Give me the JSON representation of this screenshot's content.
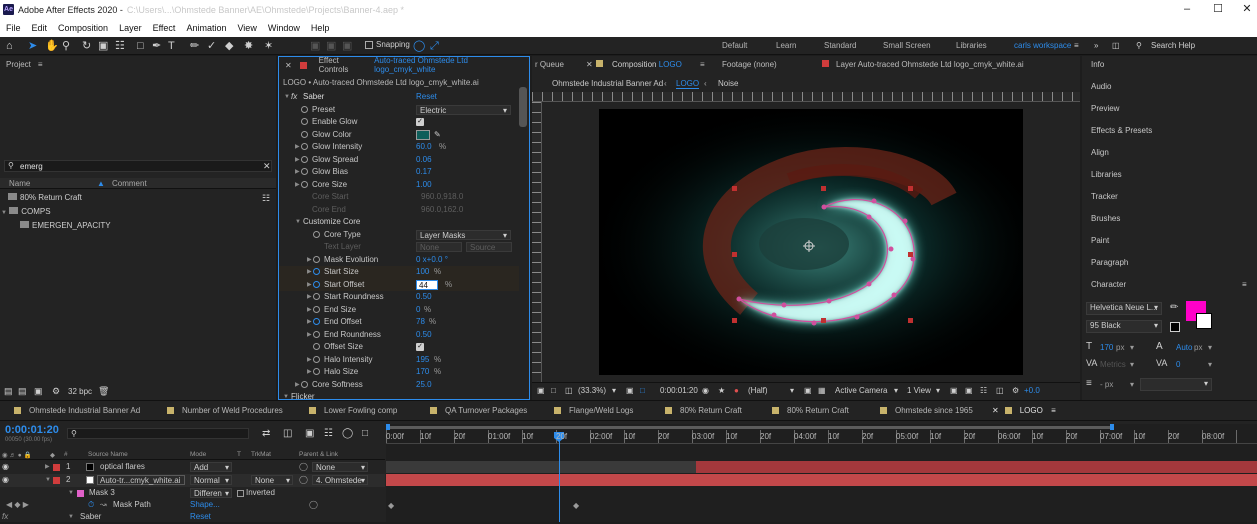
{
  "app": {
    "title": "Adobe After Effects 2020 -",
    "title_faded": "C:\\Users\\...\\Ohmstede Banner\\AE\\Ohmstede\\Projects\\Banner-4.aep *"
  },
  "menu": [
    "File",
    "Edit",
    "Composition",
    "Layer",
    "Effect",
    "Animation",
    "View",
    "Window",
    "Help"
  ],
  "toolbar": {
    "snapping": "Snapping",
    "workspaces": [
      "Default",
      "Learn",
      "Standard",
      "Small Screen",
      "Libraries"
    ],
    "active_workspace": "carls workspace",
    "search_placeholder": "Search Help"
  },
  "project": {
    "title": "Project",
    "search_value": "emerg",
    "col_name": "Name",
    "col_comment": "Comment",
    "items": [
      "80% Return Craft",
      "COMPS",
      "EMERGEN_APACITY"
    ],
    "bpc": "32 bpc"
  },
  "effect_controls": {
    "tab_prefix": "Effect Controls",
    "tab_layer": "Auto-traced Ohmstede Ltd logo_cmyk_white",
    "breadcrumb": "LOGO • Auto-traced Ohmstede Ltd logo_cmyk_white.ai",
    "fx_name": "Saber",
    "reset": "Reset",
    "rows": [
      {
        "label": "Preset",
        "value": "Electric",
        "kind": "dropdown"
      },
      {
        "label": "Enable Glow",
        "value": "✓",
        "kind": "check"
      },
      {
        "label": "Glow Color",
        "value": "",
        "kind": "color"
      },
      {
        "label": "Glow Intensity",
        "value": "60.0",
        "unit": "%"
      },
      {
        "label": "Glow Spread",
        "value": "0.06"
      },
      {
        "label": "Glow Bias",
        "value": "0.17"
      },
      {
        "label": "Core Size",
        "value": "1.00"
      },
      {
        "label": "Core Start",
        "value": "960.0,918.0",
        "kind": "dim"
      },
      {
        "label": "Core End",
        "value": "960.0,162.0",
        "kind": "dim"
      },
      {
        "label": "Customize Core",
        "value": "",
        "kind": "group"
      },
      {
        "label": "Core Type",
        "value": "Layer Masks",
        "kind": "dropdown"
      },
      {
        "label": "Text Layer",
        "value": "None",
        "value2": "Source",
        "kind": "dimdd"
      },
      {
        "label": "Mask Evolution",
        "value": "0 x+0.0 °"
      },
      {
        "label": "Start Size",
        "value": "100",
        "unit": "%"
      },
      {
        "label": "Start Offset",
        "value": "44",
        "unit": "%",
        "kind": "edit"
      },
      {
        "label": "Start Roundness",
        "value": "0.50"
      },
      {
        "label": "End Size",
        "value": "0",
        "unit": "%"
      },
      {
        "label": "End Offset",
        "value": "78",
        "unit": "%"
      },
      {
        "label": "End Roundness",
        "value": "0.50"
      },
      {
        "label": "Offset Size",
        "value": "✓",
        "kind": "check"
      },
      {
        "label": "Halo Intensity",
        "value": "195",
        "unit": "%"
      },
      {
        "label": "Halo Size",
        "value": "170",
        "unit": "%"
      },
      {
        "label": "Core Softness",
        "value": "25.0"
      },
      {
        "label": "Flicker",
        "value": "",
        "kind": "group"
      }
    ]
  },
  "viewer": {
    "tabs": [
      "r Queue",
      "Composition LOGO",
      "Footage (none)",
      "Layer Auto-traced Ohmstede Ltd logo_cmyk_white.ai"
    ],
    "nav": [
      "Ohmstede Industrial Banner Ad",
      "LOGO",
      "Noise"
    ],
    "zoom": "(33.3%)",
    "time": "0:00:01:20",
    "resolution": "(Half)",
    "camera": "Active Camera",
    "views": "1 View",
    "exposure": "+0.0"
  },
  "right_panels": [
    "Info",
    "Audio",
    "Preview",
    "Effects & Presets",
    "Align",
    "Libraries",
    "Tracker",
    "Brushes",
    "Paint",
    "Paragraph",
    "Character"
  ],
  "character": {
    "font": "Helvetica Neue L...",
    "style": "95 Black",
    "size": "170",
    "size_unit": "px",
    "leading": "Auto",
    "leading_unit": "px",
    "metrics": "Metrics",
    "tracking": "0",
    "px_label": "- px",
    "fill_color": "#ff00c8"
  },
  "timeline": {
    "comps": [
      "Ohmstede Industrial Banner Ad",
      "Number of Weld Procedures",
      "Lower Fowling comp",
      "QA Turnover Packages",
      "Flange/Weld Logs",
      "80% Return Craft",
      "80% Return Craft",
      "Ohmstede since 1965",
      "LOGO"
    ],
    "timecode": "0:00:01:20",
    "frame_info": "00050 (30.00 fps)",
    "columns": [
      "Source Name",
      "Mode",
      "T",
      "TrkMat",
      "Parent & Link"
    ],
    "ruler": [
      "0:00f",
      "10f",
      "20f",
      "01:00f",
      "10f",
      "20f",
      "02:00f",
      "10f",
      "20f",
      "03:00f",
      "10f",
      "20f",
      "04:00f",
      "10f",
      "20f",
      "05:00f",
      "10f",
      "20f",
      "06:00f",
      "10f",
      "20f",
      "07:00f",
      "10f",
      "20f",
      "08:00f"
    ],
    "layers": [
      {
        "num": "1",
        "name": "optical flares",
        "mode": "Add",
        "trkmat": "",
        "parent": "None"
      },
      {
        "num": "2",
        "name": "Auto-tr...cmyk_white.ai",
        "mode": "Normal",
        "trkmat": "None",
        "parent": "4. Ohmstede"
      }
    ],
    "mask_name": "Mask 3",
    "mask_mode": "Differen",
    "mask_inverted": "Inverted",
    "mask_path": "Mask Path",
    "mask_path_value": "Shape...",
    "effect_name": "Saber",
    "effect_reset": "Reset"
  },
  "colors": {
    "accent": "#2d8ceb",
    "layer_bar": "#c3484a",
    "glow": "#5ff5e0",
    "mask": "#d14f9e"
  }
}
